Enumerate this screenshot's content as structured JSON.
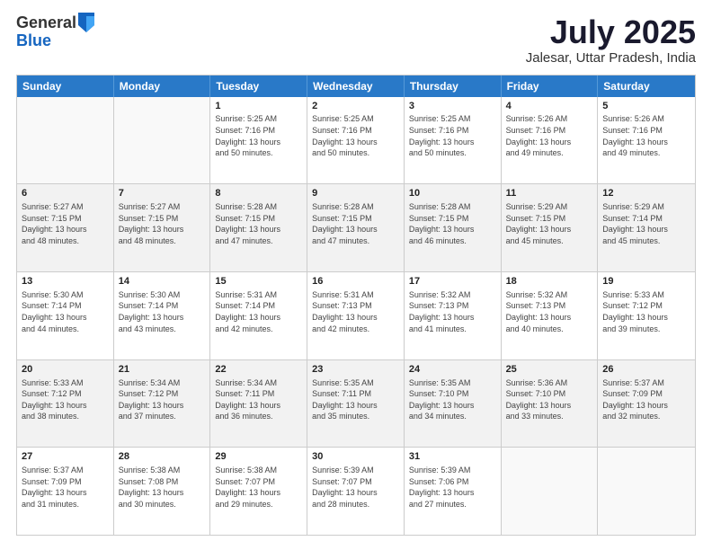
{
  "logo": {
    "general": "General",
    "blue": "Blue"
  },
  "title": "July 2025",
  "subtitle": "Jalesar, Uttar Pradesh, India",
  "days": [
    "Sunday",
    "Monday",
    "Tuesday",
    "Wednesday",
    "Thursday",
    "Friday",
    "Saturday"
  ],
  "weeks": [
    [
      {
        "day": "",
        "info": ""
      },
      {
        "day": "",
        "info": ""
      },
      {
        "day": "1",
        "info": "Sunrise: 5:25 AM\nSunset: 7:16 PM\nDaylight: 13 hours\nand 50 minutes."
      },
      {
        "day": "2",
        "info": "Sunrise: 5:25 AM\nSunset: 7:16 PM\nDaylight: 13 hours\nand 50 minutes."
      },
      {
        "day": "3",
        "info": "Sunrise: 5:25 AM\nSunset: 7:16 PM\nDaylight: 13 hours\nand 50 minutes."
      },
      {
        "day": "4",
        "info": "Sunrise: 5:26 AM\nSunset: 7:16 PM\nDaylight: 13 hours\nand 49 minutes."
      },
      {
        "day": "5",
        "info": "Sunrise: 5:26 AM\nSunset: 7:16 PM\nDaylight: 13 hours\nand 49 minutes."
      }
    ],
    [
      {
        "day": "6",
        "info": "Sunrise: 5:27 AM\nSunset: 7:15 PM\nDaylight: 13 hours\nand 48 minutes."
      },
      {
        "day": "7",
        "info": "Sunrise: 5:27 AM\nSunset: 7:15 PM\nDaylight: 13 hours\nand 48 minutes."
      },
      {
        "day": "8",
        "info": "Sunrise: 5:28 AM\nSunset: 7:15 PM\nDaylight: 13 hours\nand 47 minutes."
      },
      {
        "day": "9",
        "info": "Sunrise: 5:28 AM\nSunset: 7:15 PM\nDaylight: 13 hours\nand 47 minutes."
      },
      {
        "day": "10",
        "info": "Sunrise: 5:28 AM\nSunset: 7:15 PM\nDaylight: 13 hours\nand 46 minutes."
      },
      {
        "day": "11",
        "info": "Sunrise: 5:29 AM\nSunset: 7:15 PM\nDaylight: 13 hours\nand 45 minutes."
      },
      {
        "day": "12",
        "info": "Sunrise: 5:29 AM\nSunset: 7:14 PM\nDaylight: 13 hours\nand 45 minutes."
      }
    ],
    [
      {
        "day": "13",
        "info": "Sunrise: 5:30 AM\nSunset: 7:14 PM\nDaylight: 13 hours\nand 44 minutes."
      },
      {
        "day": "14",
        "info": "Sunrise: 5:30 AM\nSunset: 7:14 PM\nDaylight: 13 hours\nand 43 minutes."
      },
      {
        "day": "15",
        "info": "Sunrise: 5:31 AM\nSunset: 7:14 PM\nDaylight: 13 hours\nand 42 minutes."
      },
      {
        "day": "16",
        "info": "Sunrise: 5:31 AM\nSunset: 7:13 PM\nDaylight: 13 hours\nand 42 minutes."
      },
      {
        "day": "17",
        "info": "Sunrise: 5:32 AM\nSunset: 7:13 PM\nDaylight: 13 hours\nand 41 minutes."
      },
      {
        "day": "18",
        "info": "Sunrise: 5:32 AM\nSunset: 7:13 PM\nDaylight: 13 hours\nand 40 minutes."
      },
      {
        "day": "19",
        "info": "Sunrise: 5:33 AM\nSunset: 7:12 PM\nDaylight: 13 hours\nand 39 minutes."
      }
    ],
    [
      {
        "day": "20",
        "info": "Sunrise: 5:33 AM\nSunset: 7:12 PM\nDaylight: 13 hours\nand 38 minutes."
      },
      {
        "day": "21",
        "info": "Sunrise: 5:34 AM\nSunset: 7:12 PM\nDaylight: 13 hours\nand 37 minutes."
      },
      {
        "day": "22",
        "info": "Sunrise: 5:34 AM\nSunset: 7:11 PM\nDaylight: 13 hours\nand 36 minutes."
      },
      {
        "day": "23",
        "info": "Sunrise: 5:35 AM\nSunset: 7:11 PM\nDaylight: 13 hours\nand 35 minutes."
      },
      {
        "day": "24",
        "info": "Sunrise: 5:35 AM\nSunset: 7:10 PM\nDaylight: 13 hours\nand 34 minutes."
      },
      {
        "day": "25",
        "info": "Sunrise: 5:36 AM\nSunset: 7:10 PM\nDaylight: 13 hours\nand 33 minutes."
      },
      {
        "day": "26",
        "info": "Sunrise: 5:37 AM\nSunset: 7:09 PM\nDaylight: 13 hours\nand 32 minutes."
      }
    ],
    [
      {
        "day": "27",
        "info": "Sunrise: 5:37 AM\nSunset: 7:09 PM\nDaylight: 13 hours\nand 31 minutes."
      },
      {
        "day": "28",
        "info": "Sunrise: 5:38 AM\nSunset: 7:08 PM\nDaylight: 13 hours\nand 30 minutes."
      },
      {
        "day": "29",
        "info": "Sunrise: 5:38 AM\nSunset: 7:07 PM\nDaylight: 13 hours\nand 29 minutes."
      },
      {
        "day": "30",
        "info": "Sunrise: 5:39 AM\nSunset: 7:07 PM\nDaylight: 13 hours\nand 28 minutes."
      },
      {
        "day": "31",
        "info": "Sunrise: 5:39 AM\nSunset: 7:06 PM\nDaylight: 13 hours\nand 27 minutes."
      },
      {
        "day": "",
        "info": ""
      },
      {
        "day": "",
        "info": ""
      }
    ]
  ]
}
